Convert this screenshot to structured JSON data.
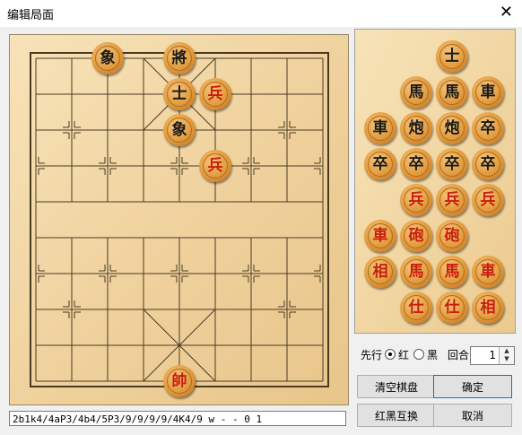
{
  "window": {
    "title": "编辑局面",
    "close_label": "✕"
  },
  "colors": {
    "board_light": "#f6e0b2",
    "board_dark": "#ecc98c",
    "line": "#4a3a22",
    "red_text": "#c81e0f",
    "black_text": "#1a1a1a"
  },
  "board": {
    "pieces": [
      {
        "char": "象",
        "side": "black",
        "col": 1,
        "row": 0
      },
      {
        "char": "將",
        "side": "black",
        "col": 3,
        "row": 0
      },
      {
        "char": "士",
        "side": "black",
        "col": 3,
        "row": 1
      },
      {
        "char": "兵",
        "side": "red",
        "col": 4,
        "row": 1
      },
      {
        "char": "象",
        "side": "black",
        "col": 3,
        "row": 2
      },
      {
        "char": "兵",
        "side": "red",
        "col": 4,
        "row": 3
      },
      {
        "char": "帥",
        "side": "red",
        "col": 3,
        "row": 9
      }
    ]
  },
  "reserve": {
    "pieces": [
      {
        "char": "士",
        "side": "black",
        "col": 2,
        "row": 0
      },
      {
        "char": "馬",
        "side": "black",
        "col": 1,
        "row": 1
      },
      {
        "char": "馬",
        "side": "black",
        "col": 2,
        "row": 1
      },
      {
        "char": "車",
        "side": "black",
        "col": 3,
        "row": 1
      },
      {
        "char": "車",
        "side": "black",
        "col": 0,
        "row": 2
      },
      {
        "char": "炮",
        "side": "black",
        "col": 1,
        "row": 2
      },
      {
        "char": "炮",
        "side": "black",
        "col": 2,
        "row": 2
      },
      {
        "char": "卒",
        "side": "black",
        "col": 3,
        "row": 2
      },
      {
        "char": "卒",
        "side": "black",
        "col": 0,
        "row": 3
      },
      {
        "char": "卒",
        "side": "black",
        "col": 1,
        "row": 3
      },
      {
        "char": "卒",
        "side": "black",
        "col": 2,
        "row": 3
      },
      {
        "char": "卒",
        "side": "black",
        "col": 3,
        "row": 3
      },
      {
        "char": "兵",
        "side": "red",
        "col": 1,
        "row": 4
      },
      {
        "char": "兵",
        "side": "red",
        "col": 2,
        "row": 4
      },
      {
        "char": "兵",
        "side": "red",
        "col": 3,
        "row": 4
      },
      {
        "char": "車",
        "side": "red",
        "col": 0,
        "row": 5
      },
      {
        "char": "砲",
        "side": "red",
        "col": 1,
        "row": 5
      },
      {
        "char": "砲",
        "side": "red",
        "col": 2,
        "row": 5
      },
      {
        "char": "相",
        "side": "red",
        "col": 0,
        "row": 6
      },
      {
        "char": "馬",
        "side": "red",
        "col": 1,
        "row": 6
      },
      {
        "char": "馬",
        "side": "red",
        "col": 2,
        "row": 6
      },
      {
        "char": "車",
        "side": "red",
        "col": 3,
        "row": 6
      },
      {
        "char": "仕",
        "side": "red",
        "col": 1,
        "row": 7
      },
      {
        "char": "仕",
        "side": "red",
        "col": 2,
        "row": 7
      },
      {
        "char": "相",
        "side": "red",
        "col": 3,
        "row": 7
      }
    ]
  },
  "controls": {
    "first_move_label": "先行",
    "red_label": "红",
    "black_label": "黑",
    "red_selected": true,
    "round_label": "回合",
    "round_value": "1"
  },
  "buttons": {
    "clear": "清空棋盘",
    "ok": "确定",
    "swap": "红黑互换",
    "cancel": "取消"
  },
  "fen": "2b1k4/4aP3/4b4/5P3/9/9/9/9/4K4/9 w - - 0 1"
}
